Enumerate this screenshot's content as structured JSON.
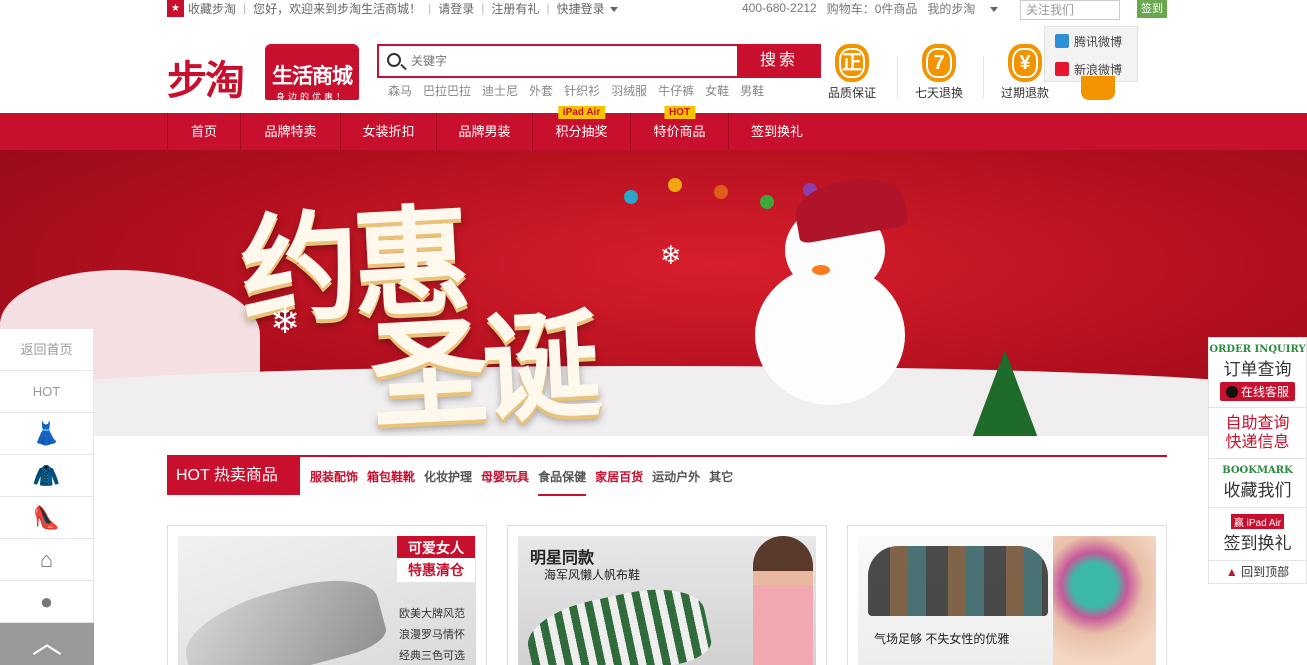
{
  "topbar": {
    "fav_icon": "★",
    "bookmark": "收藏步淘",
    "welcome": "您好，欢迎来到步淘生活商城！",
    "login": "请登录",
    "register": "注册有礼",
    "quick_login": "快捷登录",
    "phone": "400-680-2212",
    "cart": "购物车：0件商品",
    "my_butao": "我的步淘",
    "follow_us": "关注我们",
    "signin": "签到",
    "weibo_tencent": "腾讯微博",
    "weibo_sina": "新浪微博"
  },
  "logo": {
    "brand": "步淘",
    "sub": "生活商城",
    "slogan": "身边的优惠！"
  },
  "search": {
    "placeholder": "关键字",
    "button": "搜索",
    "hot_words": [
      "森马",
      "巴拉巴拉",
      "迪士尼",
      "外套",
      "针织衫",
      "羽绒服",
      "牛仔裤",
      "女鞋",
      "男鞋"
    ]
  },
  "services": [
    {
      "glyph": "正",
      "label": "品质保证"
    },
    {
      "glyph": "7",
      "label": "七天退换"
    },
    {
      "glyph": "¥",
      "label": "过期退款"
    }
  ],
  "nav": {
    "items": [
      {
        "label": "首页",
        "tag": ""
      },
      {
        "label": "品牌特卖",
        "tag": ""
      },
      {
        "label": "女装折扣",
        "tag": ""
      },
      {
        "label": "品牌男装",
        "tag": ""
      },
      {
        "label": "积分抽奖",
        "tag": "iPad Air"
      },
      {
        "label": "特价商品",
        "tag": "HOT"
      },
      {
        "label": "签到换礼",
        "tag": ""
      }
    ]
  },
  "banner": {
    "line1": "约惠",
    "line2": "圣诞"
  },
  "left_float": {
    "home": "返回首页",
    "hot": "HOT",
    "icons": [
      "dress-icon",
      "jacket-icon",
      "heel-icon",
      "hanger-icon",
      "dining-icon"
    ],
    "up_arrow": "︿"
  },
  "right_float": {
    "order_en": "ORDER INQUIRY",
    "order_cn": "订单查询",
    "online": "在线客服",
    "self_service_1": "自助查询",
    "self_service_2": "快递信息",
    "bookmark_en": "BOOKMARK",
    "bookmark_cn": "收藏我们",
    "ipad_tag": "iPad Air",
    "win_tag": "赢",
    "signin_gift": "签到换礼",
    "back_top": "回到顶部"
  },
  "hot_section": {
    "title": "HOT 热卖商品",
    "categories": [
      "服装配饰",
      "箱包鞋靴",
      "化妆护理",
      "母婴玩具",
      "食品保健",
      "家居百货",
      "运动户外",
      "其它"
    ],
    "category_styles": [
      "red",
      "red",
      "grey",
      "red",
      "active",
      "red",
      "grey",
      "grey"
    ]
  },
  "products": [
    {
      "tag1": "可爱女人",
      "tag2": "特惠清仓",
      "lines": [
        "欧美大牌风范",
        "浪漫罗马情怀",
        "经典三色可选"
      ]
    },
    {
      "headline": "明星同款",
      "subline": "海军风懒人帆布鞋"
    },
    {
      "caption": "气场足够  不失女性的优雅"
    }
  ],
  "colors": {
    "brand_red": "#c8102e",
    "accent_orange": "#f29400",
    "green": "#2a8a3c"
  }
}
